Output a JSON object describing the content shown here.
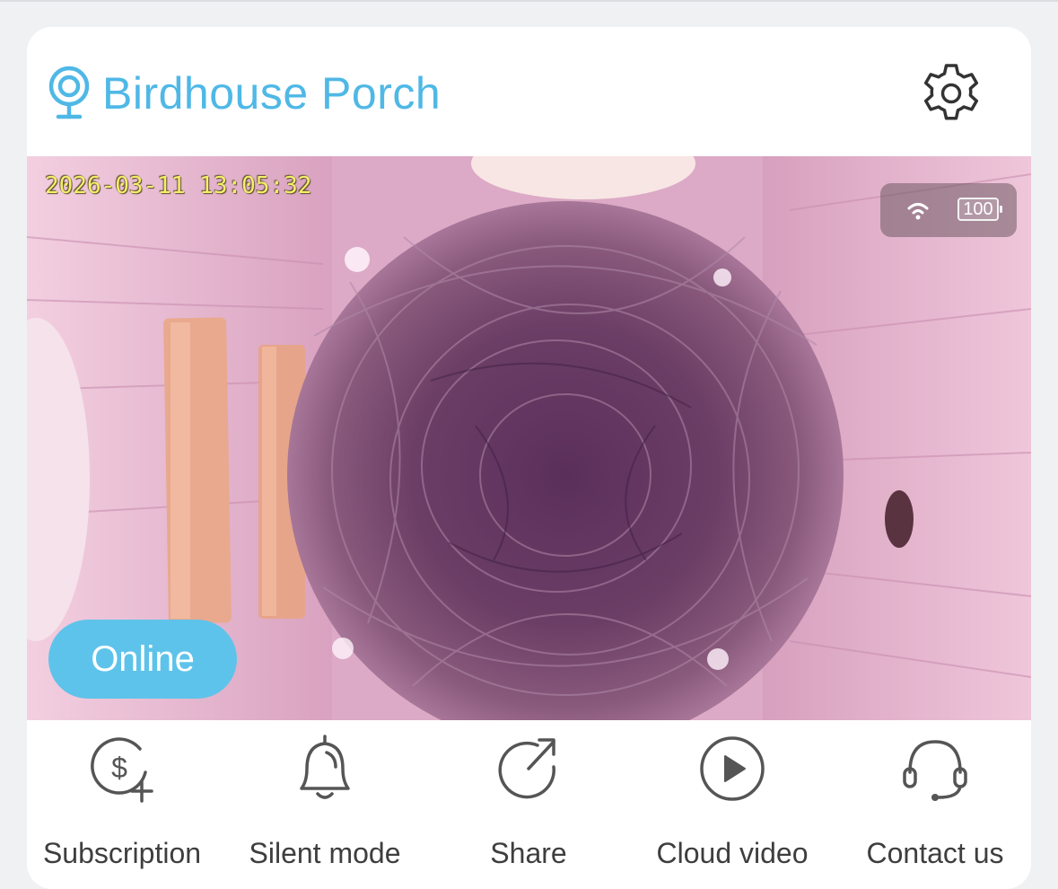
{
  "header": {
    "title": "Birdhouse Porch",
    "camera_icon": "webcam-icon",
    "settings_icon": "gear-icon",
    "accent_color": "#4fb8e6"
  },
  "video": {
    "timestamp": "2026-03-11  13:05:32",
    "wifi_icon": "wifi-icon",
    "battery_level": "100",
    "status": "Online",
    "status_color": "#5ec3ea"
  },
  "toolbar": {
    "items": [
      {
        "label": "Subscription",
        "icon": "dollar-plus-icon"
      },
      {
        "label": "Silent mode",
        "icon": "bell-icon"
      },
      {
        "label": "Share",
        "icon": "share-icon"
      },
      {
        "label": "Cloud video",
        "icon": "play-circle-icon"
      },
      {
        "label": "Contact us",
        "icon": "headset-icon"
      }
    ]
  }
}
